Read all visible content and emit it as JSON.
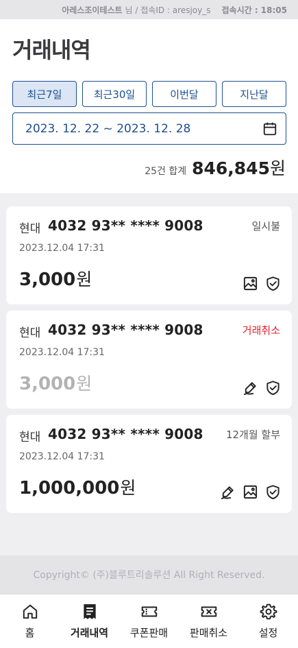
{
  "status_bar": {
    "user_name": "아레스조이테스트",
    "user_suffix": "님 / 접속ID : aresjoy_s",
    "time_label": "접속시간 : 18:05"
  },
  "page_title": "거래내역",
  "filters": [
    {
      "label": "최근7일",
      "active": true
    },
    {
      "label": "최근30일",
      "active": false
    },
    {
      "label": "이번달",
      "active": false
    },
    {
      "label": "지난달",
      "active": false
    }
  ],
  "date_range": "2023. 12. 22 ~ 2023. 12. 28",
  "summary": {
    "count_label": "25건 합계",
    "total": "846,845",
    "unit": "원"
  },
  "transactions": [
    {
      "company": "현대",
      "card_number": "4032 93** **** 9008",
      "payment_type": "일시불",
      "datetime": "2023.12.04  17:31",
      "amount": "3,000",
      "unit": "원",
      "icons": [
        "image-icon",
        "shield-check-icon"
      ]
    },
    {
      "company": "현대",
      "card_number": "4032 93** **** 9008",
      "payment_type": "거래취소",
      "datetime": "2023.12.04  17:31",
      "amount": "3,000",
      "unit": "원",
      "icons": [
        "signature-icon",
        "shield-check-icon"
      ]
    },
    {
      "company": "현대",
      "card_number": "4032 93** **** 9008",
      "payment_type": "12개월 할부",
      "datetime": "2023.12.04  17:31",
      "amount": "1,000,000",
      "unit": "원",
      "icons": [
        "signature-icon",
        "image-icon",
        "shield-check-icon"
      ]
    }
  ],
  "copyright": "Copyright© (주)블루트리솔루션 All Right Reserved.",
  "bottom_nav": [
    {
      "label": "홈",
      "icon": "home-icon",
      "active": false
    },
    {
      "label": "거래내역",
      "icon": "receipt-icon",
      "active": true
    },
    {
      "label": "쿠폰판매",
      "icon": "ticket-icon",
      "active": false
    },
    {
      "label": "판매취소",
      "icon": "ticket-cancel-icon",
      "active": false
    },
    {
      "label": "설정",
      "icon": "gear-icon",
      "active": false
    }
  ],
  "colors": {
    "accent": "#1d4f91",
    "cancel": "#e4202a"
  }
}
